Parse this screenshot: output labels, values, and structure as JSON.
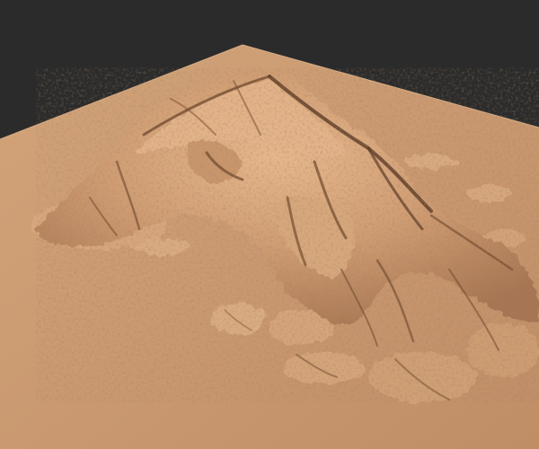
{
  "viewport": {
    "background_color": "#2b2b2b"
  },
  "terrain": {
    "sand_color": "#c99870",
    "sand_light_color": "#e2b48a",
    "rock_dark_color": "#5a3b25",
    "rock_mid_color": "#8a5e3f"
  }
}
